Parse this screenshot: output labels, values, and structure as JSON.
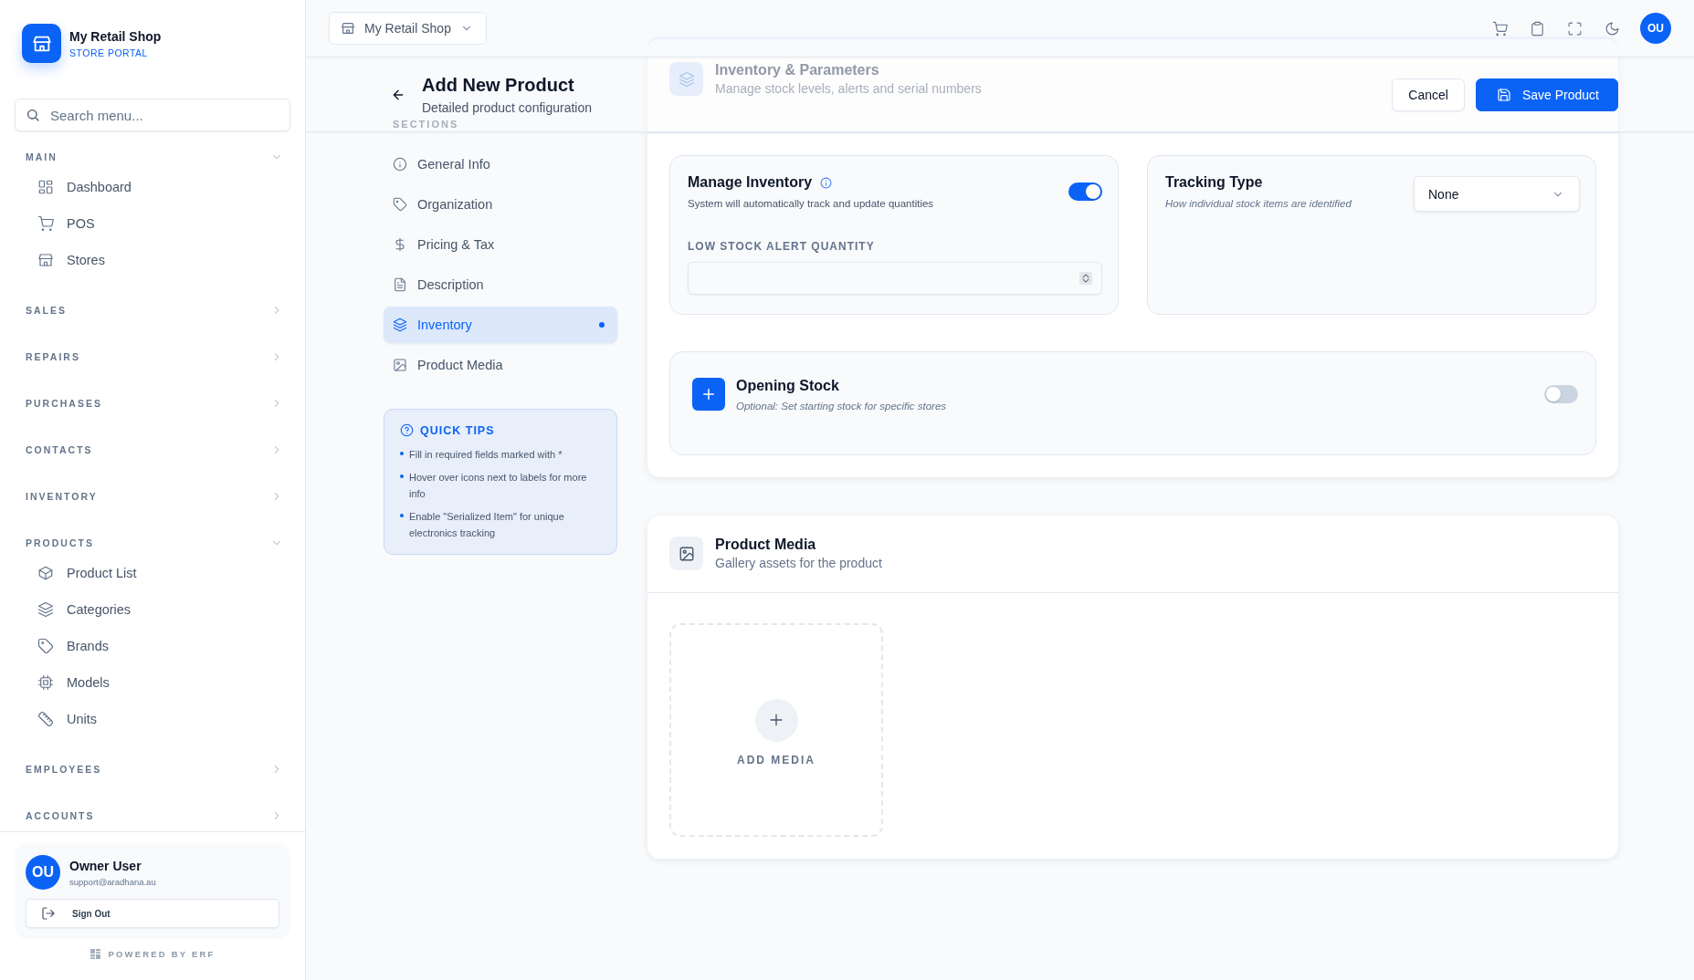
{
  "sidebar": {
    "brand": {
      "name": "My Retail Shop",
      "subtitle": "STORE PORTAL"
    },
    "search": {
      "placeholder": "Search menu..."
    },
    "groups": [
      {
        "label": "MAIN",
        "expanded": true,
        "items": [
          {
            "label": "Dashboard"
          },
          {
            "label": "POS"
          },
          {
            "label": "Stores"
          }
        ]
      },
      {
        "label": "SALES",
        "expanded": false
      },
      {
        "label": "REPAIRS",
        "expanded": false
      },
      {
        "label": "PURCHASES",
        "expanded": false
      },
      {
        "label": "CONTACTS",
        "expanded": false
      },
      {
        "label": "INVENTORY",
        "expanded": false
      },
      {
        "label": "PRODUCTS",
        "expanded": true,
        "items": [
          {
            "label": "Product List"
          },
          {
            "label": "Categories"
          },
          {
            "label": "Brands"
          },
          {
            "label": "Models"
          },
          {
            "label": "Units"
          }
        ]
      },
      {
        "label": "EMPLOYEES",
        "expanded": false
      },
      {
        "label": "ACCOUNTS",
        "expanded": false
      }
    ],
    "user": {
      "initials": "OU",
      "name": "Owner User",
      "email": "support@aradhana.au",
      "sign_out": "Sign Out"
    },
    "footer": "POWERED BY ERF"
  },
  "topbar": {
    "store_selector": "My Retail Shop",
    "avatar": "OU"
  },
  "page_header": {
    "title": "Add New Product",
    "subtitle": "Detailed product configuration",
    "buttons": [
      {
        "label": "Cancel",
        "kind": "secondary"
      },
      {
        "label": "Save Product",
        "kind": "primary"
      }
    ]
  },
  "sections": {
    "label": "SECTIONS",
    "items": [
      {
        "label": "General Info",
        "selected": false
      },
      {
        "label": "Organization",
        "selected": false
      },
      {
        "label": "Pricing & Tax",
        "selected": false
      },
      {
        "label": "Description",
        "selected": false
      },
      {
        "label": "Inventory",
        "selected": true
      },
      {
        "label": "Product Media",
        "selected": false
      }
    ]
  },
  "quick_tips": {
    "title": "QUICK TIPS",
    "tips": [
      "Fill in required fields marked with *",
      "Hover over icons next to labels for more info",
      "Enable \"Serialized Item\" for unique electronics tracking"
    ]
  },
  "inventory_card": {
    "title": "Inventory & Parameters",
    "subtitle": "Manage stock levels, alerts and serial numbers",
    "manage_inventory": {
      "title": "Manage Inventory",
      "description": "System will automatically track and update quantities",
      "on": true,
      "field_label": "LOW STOCK ALERT QUANTITY"
    },
    "tracking_type": {
      "title": "Tracking Type",
      "description": "How individual stock items are identified",
      "value": "None"
    },
    "opening_stock": {
      "title": "Opening Stock",
      "description": "Optional: Set starting stock for specific stores",
      "on": false
    }
  },
  "media_card": {
    "title": "Product Media",
    "subtitle": "Gallery assets for the product",
    "add_label": "ADD MEDIA"
  }
}
